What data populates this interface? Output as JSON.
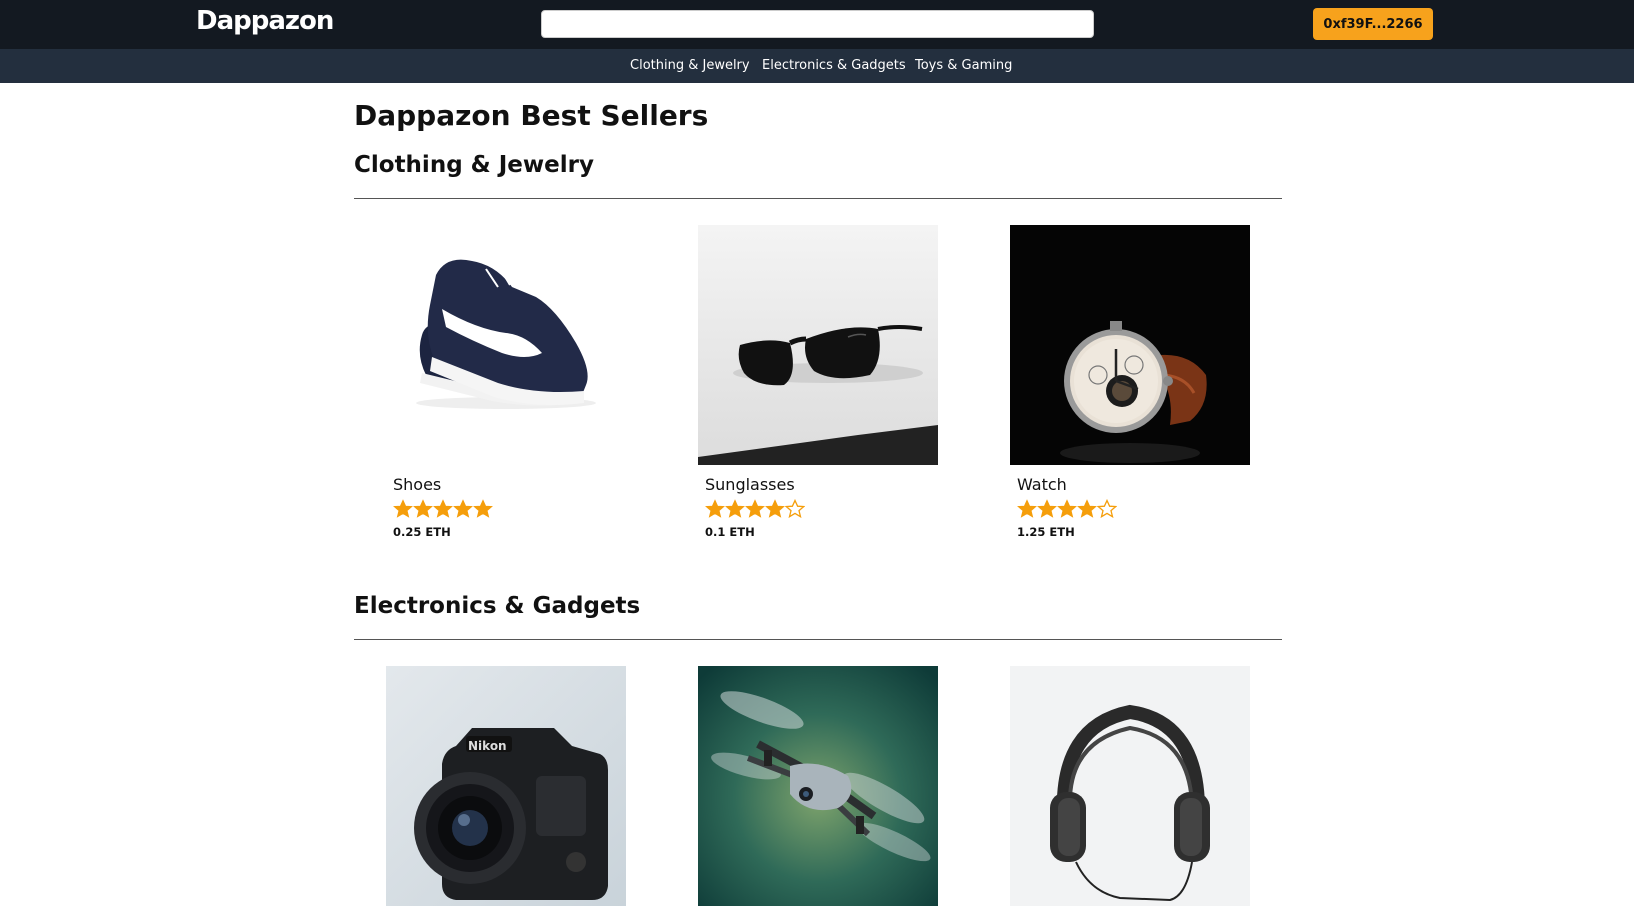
{
  "header": {
    "logo": "Dappazon",
    "search": {
      "value": "",
      "placeholder": ""
    },
    "account_label": "0xf39F...2266"
  },
  "nav": {
    "items": [
      {
        "label": "Clothing & Jewelry"
      },
      {
        "label": "Electronics & Gadgets"
      },
      {
        "label": "Toys & Gaming"
      }
    ]
  },
  "main": {
    "title": "Dappazon Best Sellers",
    "sections": [
      {
        "title": "Clothing & Jewelry",
        "products": [
          {
            "name": "Shoes",
            "rating": 5,
            "max_rating": 5,
            "price": "0.25 ETH",
            "image": "sneaker"
          },
          {
            "name": "Sunglasses",
            "rating": 4,
            "max_rating": 5,
            "price": "0.1 ETH",
            "image": "sunglasses"
          },
          {
            "name": "Watch",
            "rating": 4,
            "max_rating": 5,
            "price": "1.25 ETH",
            "image": "wristwatch"
          }
        ]
      },
      {
        "title": "Electronics & Gadgets",
        "products": [
          {
            "image": "camera"
          },
          {
            "image": "drone"
          },
          {
            "image": "headphones"
          }
        ]
      }
    ]
  },
  "colors": {
    "topbar": "#131921",
    "subnav": "#232f3e",
    "accent": "#f7a21c",
    "star": "#f59e0b"
  }
}
